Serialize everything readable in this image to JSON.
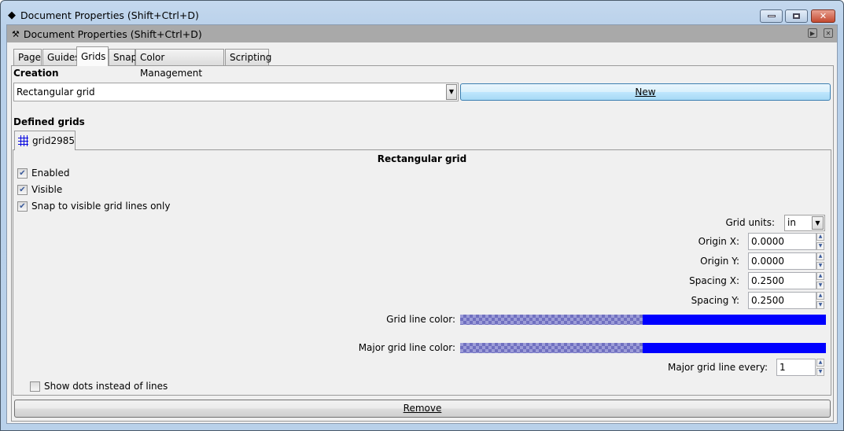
{
  "window": {
    "title": "Document Properties (Shift+Ctrl+D)",
    "dock_title": "Document Properties (Shift+Ctrl+D)"
  },
  "tabs": [
    {
      "label": "Page"
    },
    {
      "label": "Guides"
    },
    {
      "label": "Grids",
      "active": true
    },
    {
      "label": "Snap"
    },
    {
      "label": "Color Management"
    },
    {
      "label": "Scripting"
    }
  ],
  "creation": {
    "heading": "Creation",
    "grid_type": "Rectangular grid",
    "new_label": "New"
  },
  "defined": {
    "heading": "Defined grids",
    "grid_tab": "grid2985"
  },
  "grid": {
    "title": "Rectangular grid",
    "enabled": {
      "label": "Enabled",
      "checked": true
    },
    "visible": {
      "label": "Visible",
      "checked": true
    },
    "snap_visible": {
      "label": "Snap to visible grid lines only",
      "checked": true
    },
    "units_label": "Grid units:",
    "units": "in",
    "origin_x_label": "Origin X:",
    "origin_x": "0.0000",
    "origin_y_label": "Origin Y:",
    "origin_y": "0.0000",
    "spacing_x_label": "Spacing X:",
    "spacing_x": "0.2500",
    "spacing_y_label": "Spacing Y:",
    "spacing_y": "0.2500",
    "line_color_label": "Grid line color:",
    "line_color": "#0000ff",
    "major_color_label": "Major grid line color:",
    "major_color": "#0000ff",
    "major_every_label": "Major grid line every:",
    "major_every": "1",
    "dots": {
      "label": "Show dots instead of lines",
      "checked": false
    }
  },
  "remove_label": "Remove"
}
